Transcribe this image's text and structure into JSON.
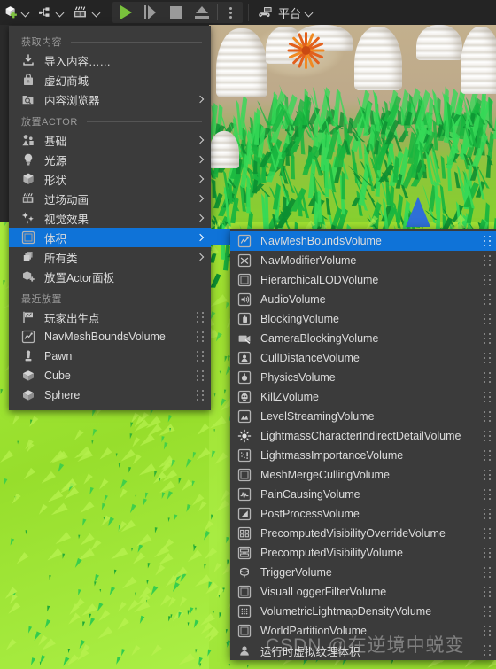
{
  "toolbar": {
    "items": [
      {
        "name": "add-actor-dropdown",
        "icon": "cube-plus-icon",
        "label": ""
      },
      {
        "name": "blueprints-dropdown",
        "icon": "blueprint-node-icon",
        "label": ""
      },
      {
        "name": "cinematics-dropdown",
        "icon": "clapperboard-icon",
        "label": ""
      }
    ],
    "play_controls": [
      {
        "name": "play-button",
        "icon": "play-icon"
      },
      {
        "name": "skip-button",
        "icon": "step-forward-icon"
      },
      {
        "name": "stop-button",
        "icon": "stop-icon"
      },
      {
        "name": "eject-button",
        "icon": "eject-icon"
      },
      {
        "name": "play-options-button",
        "icon": "kebab-menu-icon"
      }
    ],
    "platform": {
      "icon": "gamepad-icon",
      "label": "平台"
    }
  },
  "menu": {
    "sections": [
      {
        "title": "获取内容",
        "items": [
          {
            "label": "导入内容……",
            "icon": "import-icon",
            "arrow": false
          },
          {
            "label": "虚幻商城",
            "icon": "marketplace-bag-icon",
            "arrow": false
          },
          {
            "label": "内容浏览器",
            "icon": "content-browser-icon",
            "arrow": true
          }
        ]
      },
      {
        "title": "放置ACTOR",
        "items": [
          {
            "label": "基础",
            "icon": "basic-shapes-icon",
            "arrow": true
          },
          {
            "label": "光源",
            "icon": "light-bulb-icon",
            "arrow": true
          },
          {
            "label": "形状",
            "icon": "cube-shape-icon",
            "arrow": true
          },
          {
            "label": "过场动画",
            "icon": "clapperboard-icon",
            "arrow": true
          },
          {
            "label": "视觉效果",
            "icon": "sparkles-icon",
            "arrow": true
          },
          {
            "label": "体积",
            "icon": "volume-box-icon",
            "arrow": true,
            "selected": true
          },
          {
            "label": "所有类",
            "icon": "all-classes-icon",
            "arrow": true
          },
          {
            "label": "放置Actor面板",
            "icon": "place-actor-panel-icon",
            "arrow": false
          }
        ]
      },
      {
        "title": "最近放置",
        "items": [
          {
            "label": "玩家出生点",
            "icon": "player-start-icon",
            "grip": true
          },
          {
            "label": "NavMeshBoundsVolume",
            "icon": "navmesh-bounds-icon",
            "grip": true
          },
          {
            "label": "Pawn",
            "icon": "pawn-icon",
            "grip": true
          },
          {
            "label": "Cube",
            "icon": "cube-mesh-icon",
            "grip": true
          },
          {
            "label": "Sphere",
            "icon": "sphere-mesh-icon",
            "grip": true
          }
        ]
      }
    ]
  },
  "submenu": {
    "items": [
      {
        "label": "NavMeshBoundsVolume",
        "icon": "navmesh-bounds-icon",
        "selected": true
      },
      {
        "label": "NavModifierVolume",
        "icon": "nav-modifier-icon"
      },
      {
        "label": "HierarchicalLODVolume",
        "icon": "volume-box-icon"
      },
      {
        "label": "AudioVolume",
        "icon": "speaker-icon"
      },
      {
        "label": "BlockingVolume",
        "icon": "hand-block-icon"
      },
      {
        "label": "CameraBlockingVolume",
        "icon": "camera-block-icon"
      },
      {
        "label": "CullDistanceVolume",
        "icon": "cull-distance-icon"
      },
      {
        "label": "PhysicsVolume",
        "icon": "physics-icon"
      },
      {
        "label": "KillZVolume",
        "icon": "skull-icon"
      },
      {
        "label": "LevelStreamingVolume",
        "icon": "level-streaming-icon"
      },
      {
        "label": "LightmassCharacterIndirectDetailVolume",
        "icon": "lightmass-star-icon"
      },
      {
        "label": "LightmassImportanceVolume",
        "icon": "lightmass-importance-icon"
      },
      {
        "label": "MeshMergeCullingVolume",
        "icon": "volume-box-icon"
      },
      {
        "label": "PainCausingVolume",
        "icon": "pain-icon"
      },
      {
        "label": "PostProcessVolume",
        "icon": "post-process-icon"
      },
      {
        "label": "PrecomputedVisibilityOverrideVolume",
        "icon": "precomputed-override-icon"
      },
      {
        "label": "PrecomputedVisibilityVolume",
        "icon": "precomputed-visibility-icon"
      },
      {
        "label": "TriggerVolume",
        "icon": "trigger-icon"
      },
      {
        "label": "VisualLoggerFilterVolume",
        "icon": "volume-box-icon"
      },
      {
        "label": "VolumetricLightmapDensityVolume",
        "icon": "volumetric-lightmap-icon"
      },
      {
        "label": "WorldPartitionVolume",
        "icon": "volume-box-icon"
      },
      {
        "label": "运行时虚拟纹理体积",
        "icon": "runtime-vt-icon"
      }
    ]
  },
  "watermark": {
    "text": "CSDN @在逆境中蜕变",
    "prefix": "CSDN",
    "suffix": "@在逆境中蜕变"
  },
  "colors": {
    "accent": "#0f73d8",
    "panel": "#3b3b3b",
    "toolbar": "#242424",
    "text": "#dcdcdc",
    "play_green": "#79c13c"
  }
}
